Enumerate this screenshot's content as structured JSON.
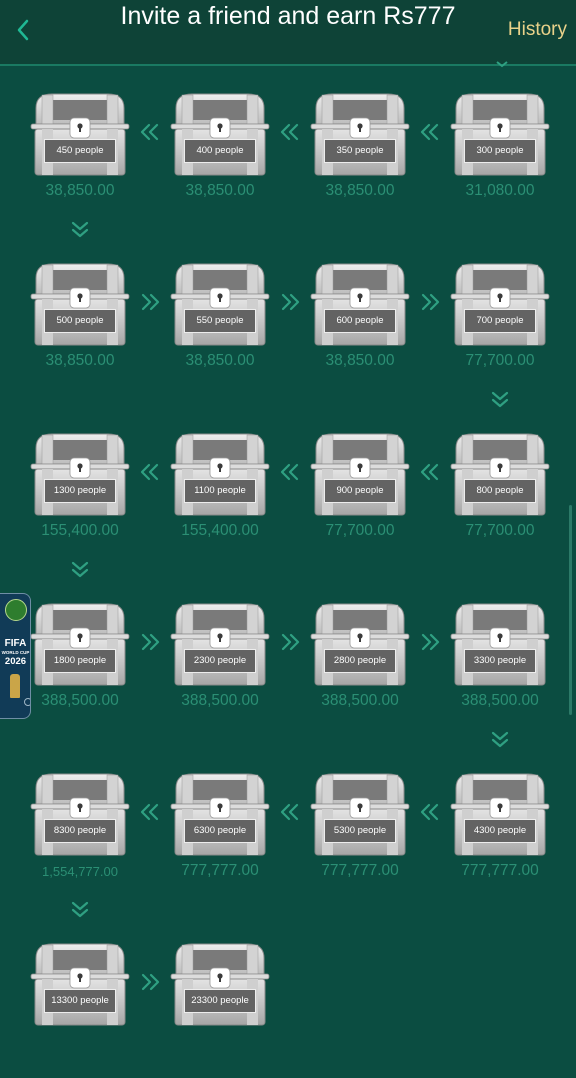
{
  "header": {
    "title": "Invite a friend and earn Rs777",
    "history_label": "History"
  },
  "tiers": [
    {
      "people": "300 people",
      "amount": "31,080.00"
    },
    {
      "people": "350 people",
      "amount": "38,850.00"
    },
    {
      "people": "400 people",
      "amount": "38,850.00"
    },
    {
      "people": "450 people",
      "amount": "38,850.00"
    },
    {
      "people": "500 people",
      "amount": "38,850.00"
    },
    {
      "people": "550 people",
      "amount": "38,850.00"
    },
    {
      "people": "600 people",
      "amount": "38,850.00"
    },
    {
      "people": "700 people",
      "amount": "77,700.00"
    },
    {
      "people": "800 people",
      "amount": "77,700.00"
    },
    {
      "people": "900 people",
      "amount": "77,700.00"
    },
    {
      "people": "1100 people",
      "amount": "155,400.00"
    },
    {
      "people": "1300 people",
      "amount": "155,400.00"
    },
    {
      "people": "1800 people",
      "amount": "388,500.00"
    },
    {
      "people": "2300 people",
      "amount": "388,500.00"
    },
    {
      "people": "2800 people",
      "amount": "388,500.00"
    },
    {
      "people": "3300 people",
      "amount": "388,500.00"
    },
    {
      "people": "4300 people",
      "amount": "777,777.00"
    },
    {
      "people": "5300 people",
      "amount": "777,777.00"
    },
    {
      "people": "6300 people",
      "amount": "777,777.00"
    },
    {
      "people": "8300 people",
      "amount": "1,554,777.00"
    },
    {
      "people": "13300 people",
      "amount": ""
    },
    {
      "people": "23300 people",
      "amount": ""
    }
  ],
  "fifa_badge": {
    "line1": "FIFA",
    "line2": "WORLD CUP",
    "line3": "2026"
  },
  "colors": {
    "background": "#0b4d41",
    "header_background": "#0e4337",
    "amount_text": "#2b8f74",
    "arrow": "#2fa082",
    "history_text": "#e9d28a"
  },
  "icons": {
    "back": "chevron-left-icon",
    "chest": "treasure-chest-icon",
    "arrow": "double-chevron-icon"
  }
}
